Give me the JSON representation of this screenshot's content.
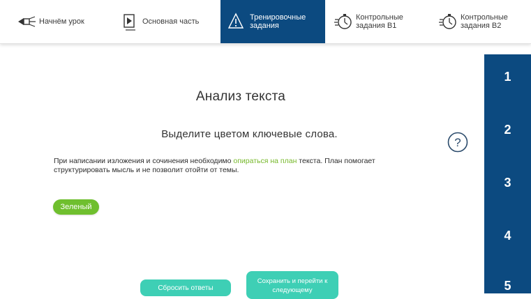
{
  "nav": {
    "items": [
      {
        "label": "Начнём урок",
        "icon": "flashlight-icon",
        "active": false
      },
      {
        "label": "Основная часть",
        "icon": "play-icon",
        "active": false
      },
      {
        "label": "Тренировочные\nзадания",
        "icon": "triangle-warning-icon",
        "active": true
      },
      {
        "label": "Контрольные\nзадания В1",
        "icon": "stopwatch-icon",
        "active": false
      },
      {
        "label": "Контрольные\nзадания В2",
        "icon": "stopwatch-icon",
        "active": false
      }
    ]
  },
  "main": {
    "title": "Анализ текста",
    "instruction": "Выделите цветом ключевые слова.",
    "paragraph": {
      "before": "При написании изложения и сочинения необходимо ",
      "highlight": "опираться на план",
      "after": " текста. План помогает структурировать мысль и не позволит отойти от темы."
    },
    "color_button": "Зеленый",
    "reset_button": "Сбросить ответы",
    "save_button": "Сохранить и перейти к\nследующему"
  },
  "sidebar": {
    "numbers": [
      "1",
      "2",
      "3",
      "4",
      "5"
    ]
  },
  "colors": {
    "nav_active": "#0c4a80",
    "sidebar": "#0c4a80",
    "highlight_green": "#76b82a",
    "green_button": "#6fbf2e",
    "action_buttons": "#3ecfb5"
  }
}
